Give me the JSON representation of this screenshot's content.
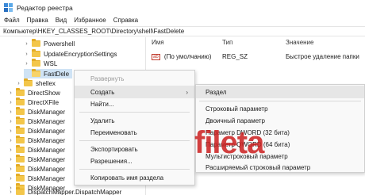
{
  "window": {
    "title": "Редактор реестра"
  },
  "menu": [
    "Файл",
    "Правка",
    "Вид",
    "Избранное",
    "Справка"
  ],
  "address": "Компьютер\\HKEY_CLASSES_ROOT\\Directory\\shell\\FastDelete",
  "tree": [
    {
      "label": "Powershell",
      "chevron": "›"
    },
    {
      "label": "UpdateEncryptionSettings",
      "chevron": "›"
    },
    {
      "label": "WSL",
      "chevron": "›"
    },
    {
      "label": "FastDele",
      "chevron": ""
    },
    {
      "label": "shellex",
      "chevron": "›"
    },
    {
      "label": "DirectShow",
      "chevron": "›"
    },
    {
      "label": "DirectXFile",
      "chevron": "›"
    },
    {
      "label": "DiskManager",
      "chevron": "›"
    },
    {
      "label": "DiskManager",
      "chevron": "›"
    },
    {
      "label": "DiskManager",
      "chevron": "›"
    },
    {
      "label": "DiskManager",
      "chevron": "›"
    },
    {
      "label": "DiskManager",
      "chevron": "›"
    },
    {
      "label": "DiskManager",
      "chevron": "›"
    },
    {
      "label": "DiskManager",
      "chevron": "›"
    },
    {
      "label": "DiskManager",
      "chevron": "›"
    },
    {
      "label": "DiskManager",
      "chevron": "›"
    },
    {
      "label": "DispatchMapper.DispatchMapper",
      "chevron": "›"
    }
  ],
  "values": {
    "columns": {
      "name": "Имя",
      "type": "Тип",
      "value": "Значение"
    },
    "rows": [
      {
        "icon": "ab",
        "name": "(По умолчанию)",
        "type": "REG_SZ",
        "value": "Быстрое удаление папки"
      }
    ]
  },
  "context_menu": {
    "items": [
      {
        "label": "Развернуть",
        "disabled": true
      },
      {
        "label": "Создать",
        "submenu": true
      },
      {
        "label": "Найти..."
      },
      {
        "label": "Удалить"
      },
      {
        "label": "Переименовать"
      },
      {
        "label": "Экспортировать"
      },
      {
        "label": "Разрешения..."
      },
      {
        "label": "Копировать имя раздела"
      }
    ],
    "submenu_arrow": "›"
  },
  "submenu": {
    "items": [
      {
        "label": "Раздел"
      },
      {
        "label": "Строковый параметр"
      },
      {
        "label": "Двоичный параметр"
      },
      {
        "label": "Параметр DWORD (32 бита)"
      },
      {
        "label": "Параметр QWORD (64 бита)"
      },
      {
        "label": "Мультистроковый параметр"
      },
      {
        "label": "Расширяемый строковый параметр"
      }
    ]
  },
  "watermark": "fileta"
}
